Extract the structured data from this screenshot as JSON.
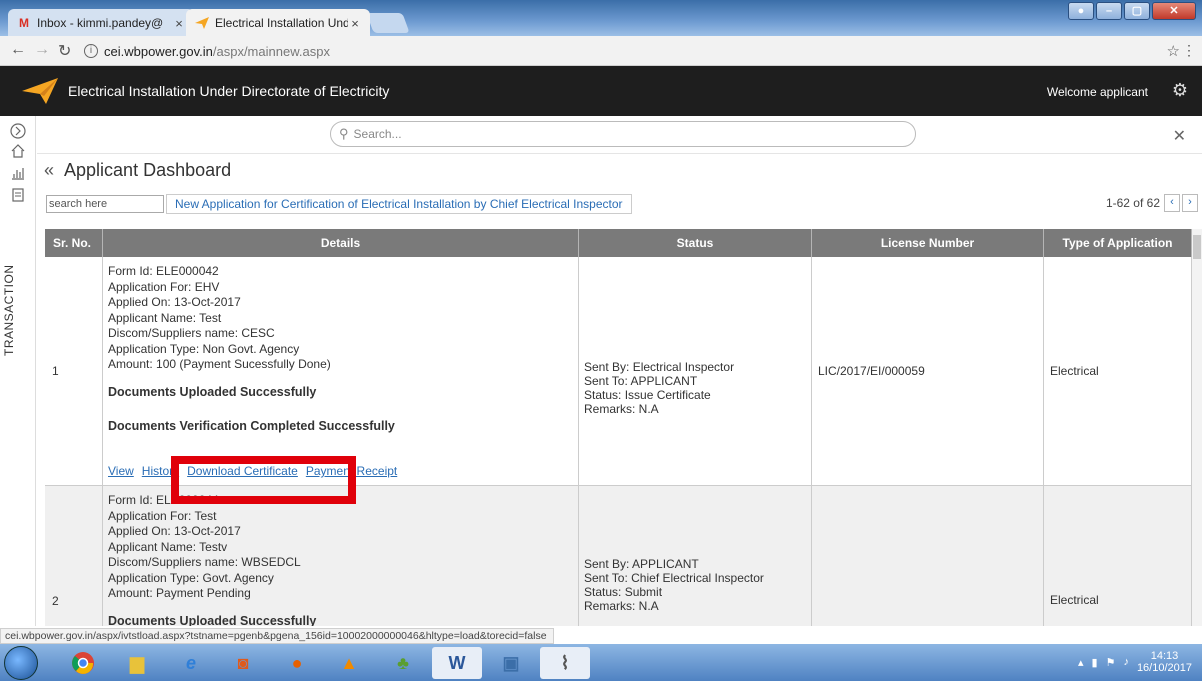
{
  "browser": {
    "tabs": [
      {
        "title": "Inbox - kimmi.pandey@",
        "favicon": "gmail-icon"
      },
      {
        "title": "Electrical Installation Und",
        "favicon": "paper-plane-icon"
      }
    ],
    "url_host": "cei.wbpower.gov.in",
    "url_path": "/aspx/mainnew.aspx",
    "status_url": "cei.wbpower.gov.in/aspx/ivtstload.aspx?tstname=pgenb&pgena_156id=10002000000046&hltype=load&torecid=false"
  },
  "header": {
    "app_title": "Electrical Installation Under Directorate of Electricity",
    "welcome": "Welcome applicant"
  },
  "sidebar": {
    "vertical_label": "TRANSACTION",
    "icons": [
      "expand-icon",
      "home-icon",
      "chart-icon",
      "document-icon"
    ]
  },
  "search": {
    "placeholder": "Search..."
  },
  "dashboard": {
    "title": "Applicant Dashboard",
    "table_search_value": "search here",
    "new_application_label": "New Application for Certification of Electrical Installation by Chief Electrical Inspector",
    "pager": "1-62 of 62"
  },
  "table": {
    "columns": [
      "Sr. No.",
      "Details",
      "Status",
      "License Number",
      "Type of Application"
    ],
    "rows": [
      {
        "sr": "1",
        "details": [
          "Form Id: ELE000042",
          "Application For: EHV",
          "Applied On: 13-Oct-2017",
          "Applicant Name: Test",
          "Discom/Suppliers name: CESC",
          "Application Type: Non Govt. Agency",
          "Amount: 100  (Payment Sucessfully Done)"
        ],
        "doc_upload": "Documents Uploaded Successfully",
        "doc_verify": "Documents Verification Completed Successfully",
        "links": [
          "View",
          "History",
          "Download Certificate",
          "Payment Receipt"
        ],
        "status": [
          "Sent By: Electrical Inspector",
          "Sent To: APPLICANT",
          "Status: Issue Certificate",
          "Remarks: N.A"
        ],
        "license": "LIC/2017/EI/000059",
        "type": "Electrical"
      },
      {
        "sr": "2",
        "details": [
          "Form Id: ELE000044",
          "Application For: Test",
          "Applied On: 13-Oct-2017",
          "Applicant Name: Testv",
          "Discom/Suppliers name: WBSEDCL",
          "Application Type: Govt. Agency",
          "Amount: Payment Pending"
        ],
        "doc_upload": "Documents Uploaded Successfully",
        "status": [
          "Sent By: APPLICANT",
          "Sent To: Chief Electrical Inspector",
          "Status: Submit",
          "Remarks: N.A"
        ],
        "license": "",
        "type": "Electrical"
      }
    ]
  },
  "taskbar": {
    "time": "14:13",
    "date": "16/10/2017"
  },
  "colors": {
    "header_bg": "#1e1e1e",
    "table_header_bg": "#7a7a7a",
    "link": "#2a6db5",
    "highlight_box": "#e0000a",
    "logo_orange": "#f5a623"
  }
}
